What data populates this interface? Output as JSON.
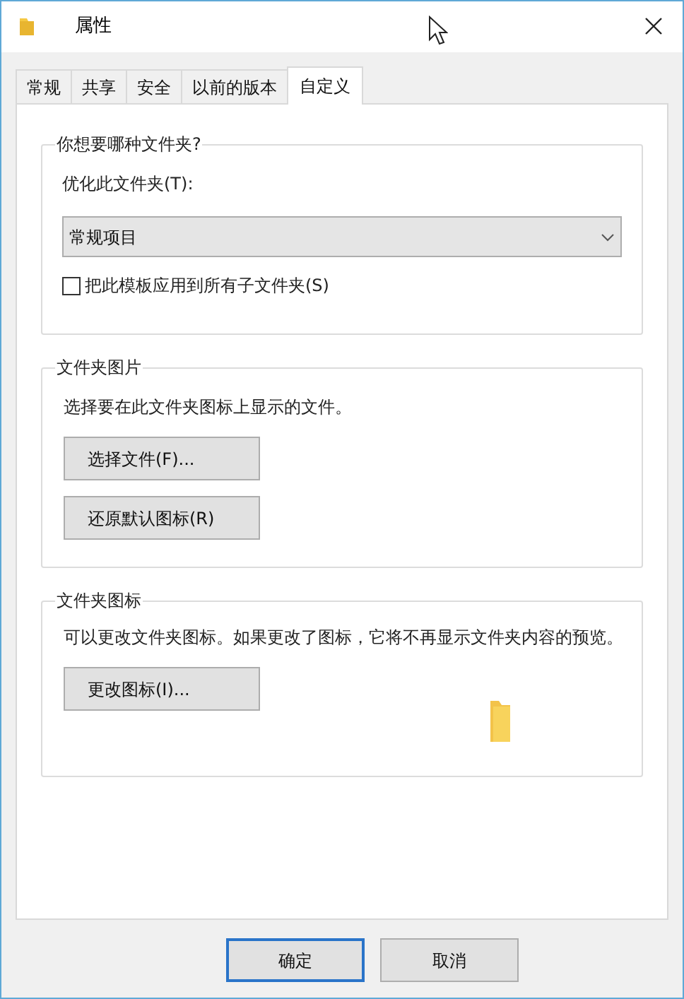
{
  "window": {
    "title": "属性"
  },
  "tabs": [
    {
      "label": "常规",
      "selected": false
    },
    {
      "label": "共享",
      "selected": false
    },
    {
      "label": "安全",
      "selected": false
    },
    {
      "label": "以前的版本",
      "selected": false
    },
    {
      "label": "自定义",
      "selected": true
    }
  ],
  "folder_type": {
    "title": "你想要哪种文件夹?",
    "optimize_label": "优化此文件夹(T):",
    "dropdown_value": "常规项目",
    "apply_to_subfolders": {
      "label": "把此模板应用到所有子文件夹(S)",
      "checked": false
    }
  },
  "folder_pictures": {
    "title": "文件夹图片",
    "description": "选择要在此文件夹图标上显示的文件。",
    "buttons": [
      "选择文件(F)...",
      "还原默认图标(R)"
    ]
  },
  "folder_icons": {
    "title": "文件夹图标",
    "description": "可以更改文件夹图标。如果更改了图标，它将不再显示文件夹内容的预览。",
    "buttons": [
      "更改图标(I)..."
    ]
  },
  "dialog_buttons": [
    {
      "label": "确定",
      "default": true
    },
    {
      "label": "取消",
      "default": false
    }
  ]
}
